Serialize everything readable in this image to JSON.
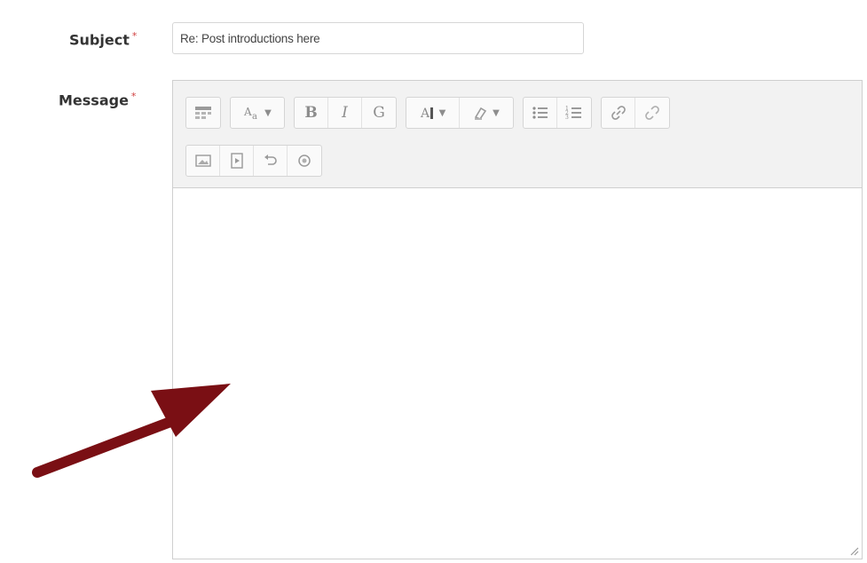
{
  "form": {
    "subject": {
      "label": "Subject",
      "required_marker": "*",
      "value": "Re: Post introductions here"
    },
    "message": {
      "label": "Message",
      "required_marker": "*",
      "value": ""
    }
  },
  "toolbar": {
    "row1": [
      {
        "group": [
          {
            "icon": "toggle-toolbar-icon"
          }
        ]
      },
      {
        "group": [
          {
            "icon": "font-style-icon",
            "dropdown": true
          }
        ]
      },
      {
        "group": [
          {
            "icon": "bold-icon",
            "glyph": "B"
          },
          {
            "icon": "italic-icon",
            "glyph": "I"
          },
          {
            "icon": "underline-icon",
            "glyph": "G"
          }
        ]
      },
      {
        "group": [
          {
            "icon": "font-color-icon",
            "dropdown": true
          },
          {
            "icon": "highlight-icon",
            "dropdown": true
          }
        ]
      },
      {
        "group": [
          {
            "icon": "bullet-list-icon"
          },
          {
            "icon": "numbered-list-icon"
          }
        ]
      },
      {
        "group": [
          {
            "icon": "link-icon"
          },
          {
            "icon": "unlink-icon"
          }
        ]
      }
    ],
    "row2": [
      {
        "group": [
          {
            "icon": "insert-image-icon"
          },
          {
            "icon": "insert-media-icon"
          },
          {
            "icon": "undo-icon"
          },
          {
            "icon": "accessibility-icon"
          }
        ]
      }
    ]
  },
  "colors": {
    "required_marker": "#d04040",
    "arrow": "#7a0f14",
    "toolbar_bg": "#f2f2f2"
  }
}
